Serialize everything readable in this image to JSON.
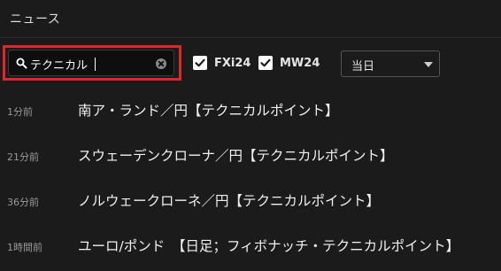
{
  "header": {
    "title": "ニュース"
  },
  "toolbar": {
    "search": {
      "value": "テクニカル",
      "placeholder": ""
    },
    "filters": [
      {
        "label": "FXi24",
        "checked": true
      },
      {
        "label": "MW24",
        "checked": true
      }
    ],
    "period_select": {
      "value": "当日"
    }
  },
  "news": [
    {
      "time": "1分前",
      "headline": "南ア・ランド／円【テクニカルポイント】"
    },
    {
      "time": "21分前",
      "headline": "スウェーデンクローナ／円【テクニカルポイント】"
    },
    {
      "time": "36分前",
      "headline": "ノルウェークローネ／円【テクニカルポイント】"
    },
    {
      "time": "1時間前",
      "headline": "ユーロ/ポンド　【日足；フィボナッチ・テクニカルポイント】"
    }
  ],
  "colors": {
    "background": "#1b1b1b",
    "highlight": "#e0262c",
    "checkbox": "#ffffff"
  }
}
